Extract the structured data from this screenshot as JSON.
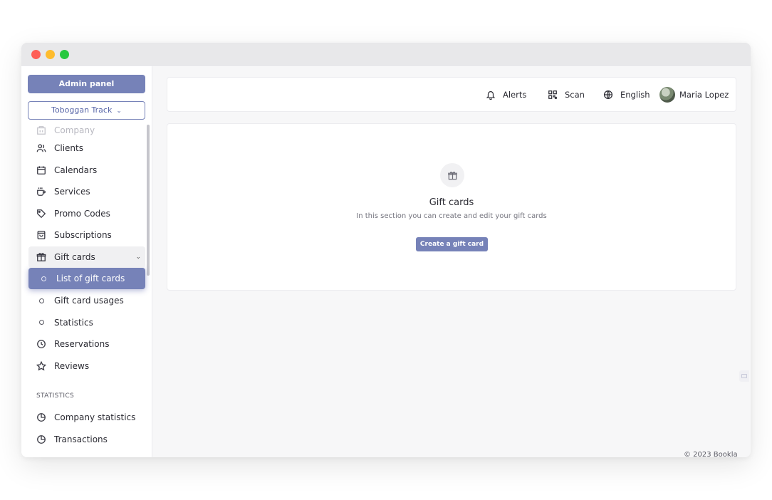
{
  "sidebar": {
    "admin_button": "Admin panel",
    "track_select": "Toboggan Track",
    "items": [
      {
        "label": "Company",
        "icon": "building-icon"
      },
      {
        "label": "Clients",
        "icon": "users-icon"
      },
      {
        "label": "Calendars",
        "icon": "calendar-icon"
      },
      {
        "label": "Services",
        "icon": "cup-icon"
      },
      {
        "label": "Promo Codes",
        "icon": "tag-icon"
      },
      {
        "label": "Subscriptions",
        "icon": "bag-icon"
      },
      {
        "label": "Gift cards",
        "icon": "gift-icon"
      }
    ],
    "gift_sub": [
      {
        "label": "List of gift cards"
      },
      {
        "label": "Gift card usages"
      },
      {
        "label": "Statistics"
      }
    ],
    "items2": [
      {
        "label": "Reservations",
        "icon": "clock-icon"
      },
      {
        "label": "Reviews",
        "icon": "star-icon"
      }
    ],
    "statistics_section": "STATISTICS",
    "stats_items": [
      {
        "label": "Company statistics",
        "icon": "pie-chart-icon"
      },
      {
        "label": "Transactions",
        "icon": "pie-chart-icon"
      }
    ]
  },
  "topbar": {
    "alerts": "Alerts",
    "scan": "Scan",
    "language": "English",
    "user": "Maria Lopez"
  },
  "main": {
    "title": "Gift cards",
    "subtitle": "In this section you can create and edit your gift cards",
    "create_button": "Create a gift card"
  },
  "footer": "© 2023 Bookla",
  "colors": {
    "accent": "#7682b8",
    "background": "#f7f7f8"
  }
}
